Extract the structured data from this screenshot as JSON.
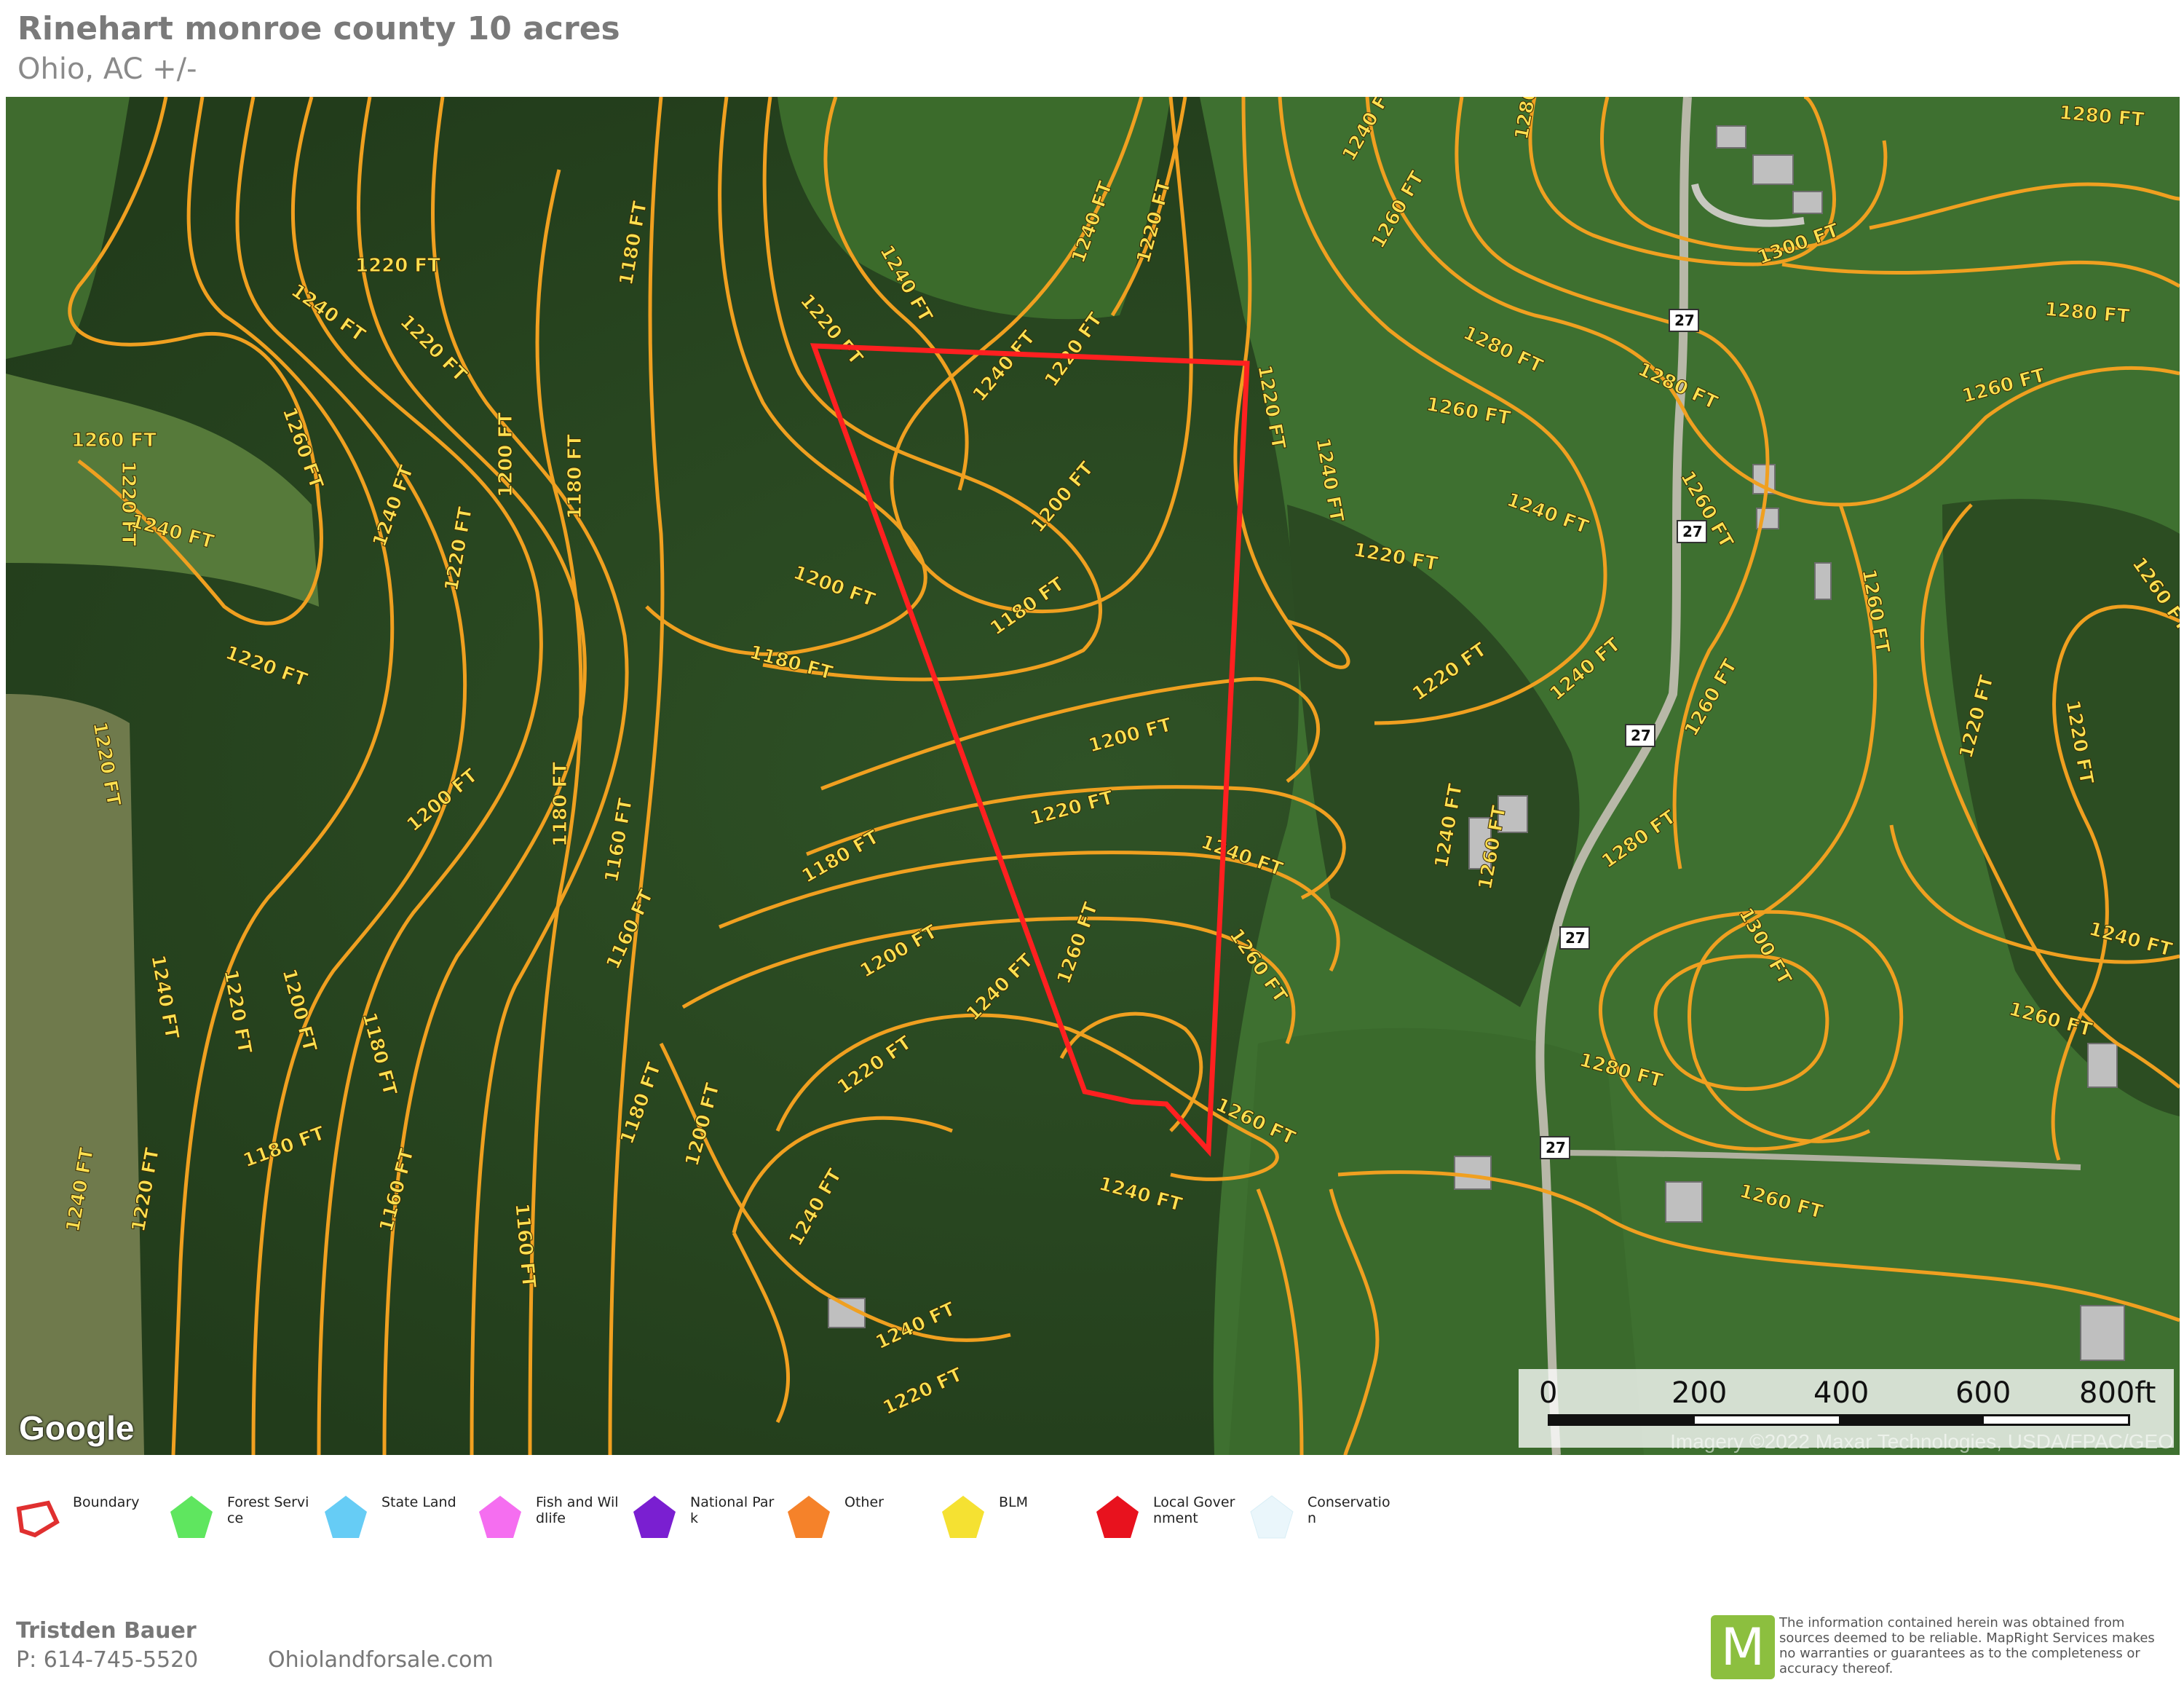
{
  "header": {
    "title": "Rinehart monroe county 10 acres",
    "subtitle": "Ohio,  AC +/-"
  },
  "map": {
    "contour_labels": [
      "1220 FT",
      "1240 FT",
      "1260 FT",
      "1200 FT",
      "1180 FT",
      "1160 FT",
      "1280 FT",
      "1300 FT"
    ],
    "road_label": "27",
    "boundary_color": "#ff2020",
    "contour_color": "#f0a020",
    "label_color": "#ffe050"
  },
  "scale": {
    "labels": [
      "0",
      "200",
      "400",
      "600",
      "800ft"
    ]
  },
  "attribution": {
    "imagery": "Imagery ©2022 Maxar Technologies, USDA/FPAC/GEO",
    "google": "Google"
  },
  "legend": [
    {
      "label": "Boundary",
      "color": "#e03030",
      "icon": "boundary-outline-icon"
    },
    {
      "label": "Forest Service",
      "color": "#5fe65f",
      "icon": "pentagon-icon"
    },
    {
      "label": "State Land",
      "color": "#66ccf5",
      "icon": "pentagon-icon"
    },
    {
      "label": "Fish and Wildlife",
      "color": "#f56ef0",
      "icon": "pentagon-icon"
    },
    {
      "label": "National Park",
      "color": "#7a1fd1",
      "icon": "pentagon-icon"
    },
    {
      "label": "Other",
      "color": "#f5822a",
      "icon": "pentagon-icon"
    },
    {
      "label": "BLM",
      "color": "#f5e132",
      "icon": "pentagon-icon"
    },
    {
      "label": "Local Government",
      "color": "#e8121e",
      "icon": "pentagon-icon"
    },
    {
      "label": "Conservation",
      "color": "#eaf6fb",
      "icon": "pentagon-icon"
    }
  ],
  "footer": {
    "agent_name": "Tristden  Bauer",
    "phone": "P: 614-745-5520",
    "website": "Ohiolandforsale.com",
    "logo_letter": "M",
    "disclaimer": "The information contained herein was obtained from sources deemed to be reliable.  MapRight Services makes no warranties or guarantees as to the completeness or accuracy thereof."
  }
}
